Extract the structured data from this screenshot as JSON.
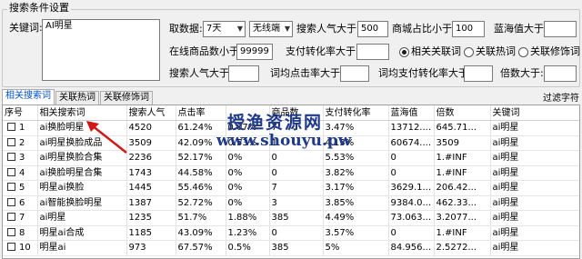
{
  "group_title": "搜索条件设置",
  "keyword_label": "关键词:",
  "keyword_value": "AI明星",
  "filters": {
    "trend_label": "取数据:",
    "trend_value": "7天",
    "device_value": "无线端",
    "pop_gt_label": "搜索人气大于:",
    "pop_gt_value": "500",
    "mall_ratio_label": "商城占比小于:",
    "mall_ratio_value": "100",
    "blue_ocean_label": "蓝海值大于:",
    "blue_ocean_value": "",
    "online_goods_label": "在线商品数小于:",
    "online_goods_value": "99999",
    "pay_conv_label": "支付转化率大于:",
    "pay_conv_value": "",
    "radio_related": "相关关联词",
    "radio_hot": "关联热词",
    "radio_modifier": "关联修饰词",
    "pop_gt2_label": "搜索人气大于:",
    "pop_gt2_value": "",
    "word_click_label": "词均点击率大于:",
    "word_click_value": "",
    "word_pay_label": "词均支付转化率大于:",
    "word_pay_value": "",
    "multiple_label": "倍数大于:",
    "multiple_value": ""
  },
  "tabs": [
    "相关搜索词",
    "关联热词",
    "关联修饰词"
  ],
  "filter_chars_label": "过滤字符",
  "watermark": {
    "line1": "授渔资源网",
    "line2": "www.shouyu.pw"
  },
  "table": {
    "headers": [
      "序号",
      "相关搜索词",
      "搜索人气",
      "点击率",
      "",
      "商品数",
      "支付转化率",
      "蓝海值",
      "倍数",
      "关键词"
    ],
    "rows": [
      [
        "1",
        "ai换脸明星",
        "4520",
        "61.24%",
        "0.07%",
        "7",
        "3.47%",
        "13712....",
        "645.71...",
        "ai明星"
      ],
      [
        "2",
        "ai明星换脸成品",
        "3509",
        "42.09%",
        "0.53%",
        "1",
        "4.13%",
        "60674....",
        "3509",
        "ai明星"
      ],
      [
        "3",
        "ai明星换脸合集",
        "2236",
        "52.17%",
        "0%",
        "0",
        "5.53%",
        "0",
        "1.#INF",
        "ai明星"
      ],
      [
        "4",
        "ai换脸明星合集",
        "1743",
        "44.58%",
        "0%",
        "0",
        "3.82%",
        "0",
        "1.#INF",
        "ai明星"
      ],
      [
        "5",
        "明星ai换脸",
        "1445",
        "55.46%",
        "0%",
        "7",
        "3.17%",
        "3629.1...",
        "206.42...",
        "ai明星"
      ],
      [
        "6",
        "ai智能换脸明星",
        "1387",
        "52.72%",
        "0%",
        "3",
        "3.85%",
        "9384.0...",
        "462.33...",
        "ai明星"
      ],
      [
        "7",
        "ai明星",
        "1235",
        "51.7%",
        "1.88%",
        "385",
        "4.49%",
        "73.063...",
        "3.2077...",
        "ai明星"
      ],
      [
        "8",
        "明星ai合成",
        "1185",
        "43.09%",
        "1.23%",
        "0",
        "3.57%",
        "0",
        "1.#INF",
        "ai明星"
      ],
      [
        "10",
        "明星ai",
        "973",
        "67.57%",
        "0.5%",
        "385",
        "5%",
        "84.956...",
        "2.5272...",
        "ai明星"
      ]
    ]
  }
}
